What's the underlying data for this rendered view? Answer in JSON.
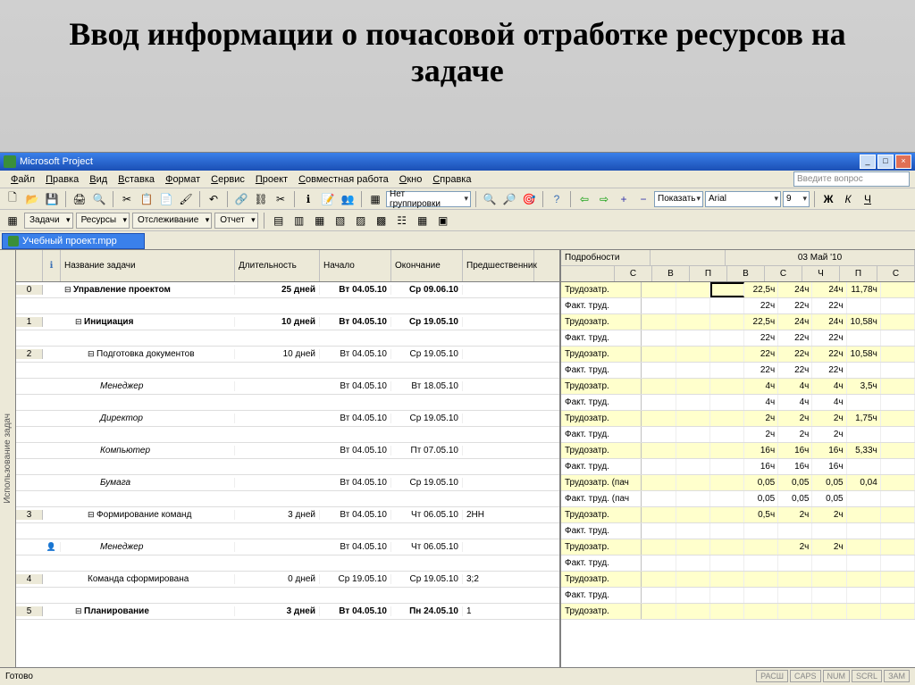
{
  "slide_title": "Ввод информации о почасовой отработке ресурсов на задаче",
  "app_title": "Microsoft Project",
  "menu": [
    "Файл",
    "Правка",
    "Вид",
    "Вставка",
    "Формат",
    "Сервис",
    "Проект",
    "Совместная работа",
    "Окно",
    "Справка"
  ],
  "help_placeholder": "Введите вопрос",
  "grouping_combo": "Нет группировки",
  "show_label": "Показать",
  "font_name": "Arial",
  "font_size": "9",
  "tabs": [
    "Задачи",
    "Ресурсы",
    "Отслеживание",
    "Отчет"
  ],
  "doc_name": "Учебный проект.mpp",
  "vtab_label": "Использование задач",
  "left_headers": {
    "name": "Название задачи",
    "duration": "Длительность",
    "start": "Начало",
    "end": "Окончание",
    "pred": "Предшественник"
  },
  "right_detail_header": "Подробности",
  "date_header": "03 Май '10",
  "day_labels": [
    "С",
    "В",
    "П",
    "В",
    "С",
    "Ч",
    "П",
    "С"
  ],
  "detail_labels": {
    "work": "Трудозатр.",
    "actual": "Факт. труд.",
    "work_pack": "Трудозатр. (пач",
    "actual_pack": "Факт. труд. (пач"
  },
  "rows": [
    {
      "num": "0",
      "name": "Управление проектом",
      "dur": "25 дней",
      "start": "Вт 04.05.10",
      "end": "Ср 09.06.10",
      "pred": "",
      "bold": true,
      "indent": 0,
      "outline": true,
      "details": [
        {
          "label": "work",
          "yellow": true,
          "cells": [
            "",
            "",
            "sel",
            "22,5ч",
            "24ч",
            "24ч",
            "11,78ч",
            ""
          ]
        },
        {
          "label": "actual",
          "yellow": false,
          "cells": [
            "",
            "",
            "",
            "22ч",
            "22ч",
            "22ч",
            "",
            ""
          ]
        }
      ]
    },
    {
      "num": "1",
      "name": "Инициация",
      "dur": "10 дней",
      "start": "Вт 04.05.10",
      "end": "Ср 19.05.10",
      "pred": "",
      "bold": true,
      "indent": 1,
      "outline": true,
      "details": [
        {
          "label": "work",
          "yellow": true,
          "cells": [
            "",
            "",
            "",
            "22,5ч",
            "24ч",
            "24ч",
            "10,58ч",
            ""
          ]
        },
        {
          "label": "actual",
          "yellow": false,
          "cells": [
            "",
            "",
            "",
            "22ч",
            "22ч",
            "22ч",
            "",
            ""
          ]
        }
      ]
    },
    {
      "num": "2",
      "name": "Подготовка документов",
      "dur": "10 дней",
      "start": "Вт 04.05.10",
      "end": "Ср 19.05.10",
      "pred": "",
      "bold": false,
      "indent": 2,
      "outline": true,
      "details": [
        {
          "label": "work",
          "yellow": true,
          "cells": [
            "",
            "",
            "",
            "22ч",
            "22ч",
            "22ч",
            "10,58ч",
            ""
          ]
        },
        {
          "label": "actual",
          "yellow": false,
          "cells": [
            "",
            "",
            "",
            "22ч",
            "22ч",
            "22ч",
            "",
            ""
          ]
        }
      ]
    },
    {
      "num": "",
      "name": "Менеджер",
      "dur": "",
      "start": "Вт 04.05.10",
      "end": "Вт 18.05.10",
      "pred": "",
      "bold": false,
      "indent": 3,
      "italic": true,
      "details": [
        {
          "label": "work",
          "yellow": true,
          "cells": [
            "",
            "",
            "",
            "4ч",
            "4ч",
            "4ч",
            "3,5ч",
            ""
          ]
        },
        {
          "label": "actual",
          "yellow": false,
          "cells": [
            "",
            "",
            "",
            "4ч",
            "4ч",
            "4ч",
            "",
            ""
          ]
        }
      ]
    },
    {
      "num": "",
      "name": "Директор",
      "dur": "",
      "start": "Вт 04.05.10",
      "end": "Ср 19.05.10",
      "pred": "",
      "bold": false,
      "indent": 3,
      "italic": true,
      "details": [
        {
          "label": "work",
          "yellow": true,
          "cells": [
            "",
            "",
            "",
            "2ч",
            "2ч",
            "2ч",
            "1,75ч",
            ""
          ]
        },
        {
          "label": "actual",
          "yellow": false,
          "cells": [
            "",
            "",
            "",
            "2ч",
            "2ч",
            "2ч",
            "",
            ""
          ]
        }
      ]
    },
    {
      "num": "",
      "name": "Компьютер",
      "dur": "",
      "start": "Вт 04.05.10",
      "end": "Пт 07.05.10",
      "pred": "",
      "bold": false,
      "indent": 3,
      "italic": true,
      "details": [
        {
          "label": "work",
          "yellow": true,
          "cells": [
            "",
            "",
            "",
            "16ч",
            "16ч",
            "16ч",
            "5,33ч",
            ""
          ]
        },
        {
          "label": "actual",
          "yellow": false,
          "cells": [
            "",
            "",
            "",
            "16ч",
            "16ч",
            "16ч",
            "",
            ""
          ]
        }
      ]
    },
    {
      "num": "",
      "name": "Бумага",
      "dur": "",
      "start": "Вт 04.05.10",
      "end": "Ср 19.05.10",
      "pred": "",
      "bold": false,
      "indent": 3,
      "italic": true,
      "details": [
        {
          "label": "work_pack",
          "yellow": true,
          "cells": [
            "",
            "",
            "",
            "0,05",
            "0,05",
            "0,05",
            "0,04",
            ""
          ]
        },
        {
          "label": "actual_pack",
          "yellow": false,
          "cells": [
            "",
            "",
            "",
            "0,05",
            "0,05",
            "0,05",
            "",
            ""
          ]
        }
      ]
    },
    {
      "num": "3",
      "name": "Формирование команд",
      "dur": "3 дней",
      "start": "Вт 04.05.10",
      "end": "Чт 06.05.10",
      "pred": "2НН",
      "bold": false,
      "indent": 2,
      "outline": true,
      "details": [
        {
          "label": "work",
          "yellow": true,
          "cells": [
            "",
            "",
            "",
            "0,5ч",
            "2ч",
            "2ч",
            "",
            ""
          ]
        },
        {
          "label": "actual",
          "yellow": false,
          "cells": [
            "",
            "",
            "",
            "",
            "",
            "",
            "",
            ""
          ]
        }
      ]
    },
    {
      "num": "",
      "name": "Менеджер",
      "dur": "",
      "start": "Вт 04.05.10",
      "end": "Чт 06.05.10",
      "pred": "",
      "bold": false,
      "indent": 3,
      "italic": true,
      "info": "person",
      "details": [
        {
          "label": "work",
          "yellow": true,
          "cells": [
            "",
            "",
            "",
            "",
            "2ч",
            "2ч",
            "",
            ""
          ]
        },
        {
          "label": "actual",
          "yellow": false,
          "cells": [
            "",
            "",
            "",
            "",
            "",
            "",
            "",
            ""
          ]
        }
      ]
    },
    {
      "num": "4",
      "name": "Команда сформирована",
      "dur": "0 дней",
      "start": "Ср 19.05.10",
      "end": "Ср 19.05.10",
      "pred": "3;2",
      "bold": false,
      "indent": 2,
      "details": [
        {
          "label": "work",
          "yellow": true,
          "cells": [
            "",
            "",
            "",
            "",
            "",
            "",
            "",
            ""
          ]
        },
        {
          "label": "actual",
          "yellow": false,
          "cells": [
            "",
            "",
            "",
            "",
            "",
            "",
            "",
            ""
          ]
        }
      ]
    },
    {
      "num": "5",
      "name": "Планирование",
      "dur": "3 дней",
      "start": "Вт 04.05.10",
      "end": "Пн 24.05.10",
      "pred": "1",
      "bold": true,
      "indent": 1,
      "outline": true,
      "details": [
        {
          "label": "work",
          "yellow": true,
          "cells": [
            "",
            "",
            "",
            "",
            "",
            "",
            "",
            ""
          ]
        }
      ]
    }
  ],
  "status_ready": "Готово",
  "status_indicators": [
    "РАСШ",
    "CAPS",
    "NUM",
    "SCRL",
    "ЗАМ"
  ]
}
